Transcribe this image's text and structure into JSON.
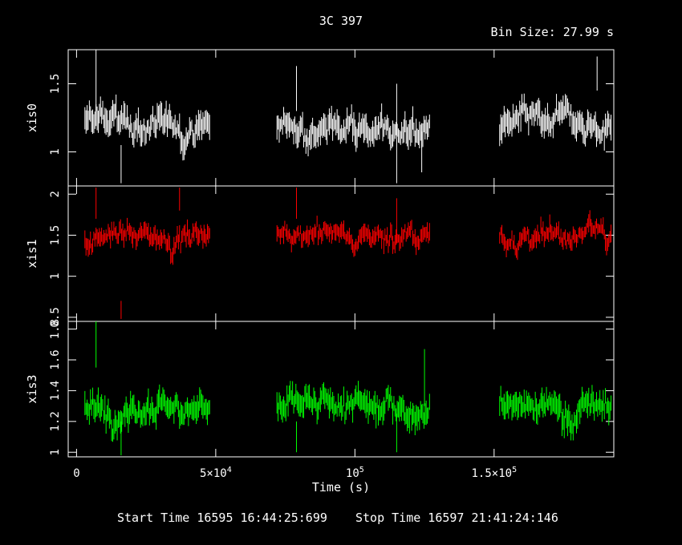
{
  "header": {
    "title": "3C 397",
    "bin_size": "Bin Size: 27.99 s"
  },
  "footer": {
    "start_time": "Start Time 16595 16:44:25:699",
    "stop_time": "Stop Time 16597 21:41:24:146"
  },
  "colors": {
    "background": "#000000",
    "xis0": "#ffffff",
    "xis1": "#ff0000",
    "xis3": "#00ff00"
  },
  "chart_data": {
    "type": "scatter",
    "xlabel": "Time (s)",
    "xlim": [
      -3000,
      193000
    ],
    "x_ticks": [
      {
        "value": 0,
        "label": "0"
      },
      {
        "value": 50000,
        "base": "5×10",
        "exp": "4"
      },
      {
        "value": 100000,
        "base": "10",
        "exp": "5"
      },
      {
        "value": 150000,
        "base": "1.5×10",
        "exp": "5"
      }
    ],
    "segments": [
      [
        3000,
        48000
      ],
      [
        72000,
        127000
      ],
      [
        152000,
        192000
      ]
    ],
    "panels": [
      {
        "name": "xis0",
        "ylabel": "xis0",
        "color": "#ffffff",
        "ylim": [
          0.75,
          1.75
        ],
        "yticks": [
          {
            "value": 1,
            "label": "1"
          },
          {
            "value": 1.5,
            "label": "1.5"
          }
        ],
        "mean": 1.2,
        "noise": 0.09,
        "err": 0.07,
        "spikes": [
          [
            7000,
            1.75,
            1.3
          ],
          [
            16000,
            0.77,
            1.05
          ],
          [
            79000,
            1.63,
            1.3
          ],
          [
            115000,
            1.5,
            0.77
          ],
          [
            124000,
            0.85,
            1.15
          ],
          [
            187000,
            1.7,
            1.45
          ]
        ]
      },
      {
        "name": "xis1",
        "ylabel": "xis1",
        "color": "#ff0000",
        "ylim": [
          0.45,
          2.1
        ],
        "yticks": [
          {
            "value": 0.5,
            "label": "0.5"
          },
          {
            "value": 1,
            "label": "1"
          },
          {
            "value": 1.5,
            "label": "1.5"
          },
          {
            "value": 2,
            "label": "2"
          }
        ],
        "mean": 1.5,
        "noise": 0.12,
        "err": 0.08,
        "spikes": [
          [
            7000,
            2.08,
            1.7
          ],
          [
            16000,
            0.48,
            0.7
          ],
          [
            37000,
            2.08,
            1.8
          ],
          [
            79000,
            2.08,
            1.7
          ],
          [
            115000,
            1.95,
            1.4
          ]
        ]
      },
      {
        "name": "xis3",
        "ylabel": "xis3",
        "color": "#00ff00",
        "ylim": [
          0.97,
          1.85
        ],
        "yticks": [
          {
            "value": 1,
            "label": "1"
          },
          {
            "value": 1.2,
            "label": "1.2"
          },
          {
            "value": 1.4,
            "label": "1.4"
          },
          {
            "value": 1.6,
            "label": "1.6"
          },
          {
            "value": 1.8,
            "label": "1.8"
          }
        ],
        "mean": 1.3,
        "noise": 0.08,
        "err": 0.06,
        "spikes": [
          [
            7000,
            1.85,
            1.55
          ],
          [
            16000,
            0.98,
            1.2
          ],
          [
            79000,
            1.0,
            1.2
          ],
          [
            115000,
            1.0,
            1.25
          ],
          [
            125000,
            1.67,
            1.3
          ]
        ]
      }
    ]
  }
}
